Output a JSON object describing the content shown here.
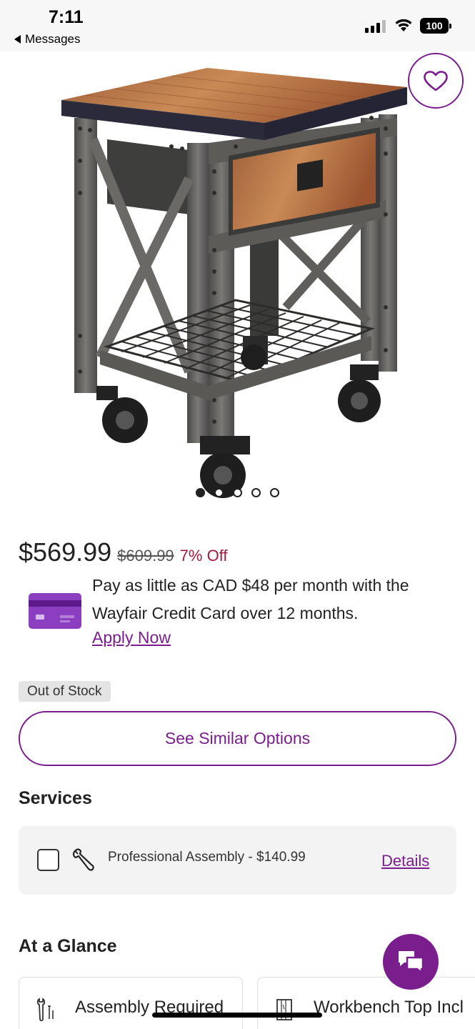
{
  "status_bar": {
    "time": "7:11",
    "back_label": "Messages",
    "battery": "100"
  },
  "product": {
    "image_alt": "Rolling workbench with wood top, drawer, wire shelf and casters",
    "image_count": 5,
    "active_image": 1
  },
  "pricing": {
    "price": "$569.99",
    "original_price": "$609.99",
    "discount": "7% Off"
  },
  "financing": {
    "text": "Pay as little as CAD $48 per month with the Wayfair Credit Card over 12 months.",
    "apply_label": "Apply Now"
  },
  "stock": {
    "badge": "Out of Stock",
    "similar_button": "See Similar Options"
  },
  "services": {
    "title": "Services",
    "item_label": "Professional Assembly - $140.99",
    "details_label": "Details",
    "checked": false
  },
  "glance": {
    "title": "At a Glance",
    "items": [
      {
        "label": "Assembly Required",
        "icon": "tools-icon"
      },
      {
        "label": "Workbench Top Incl",
        "icon": "wood-panel-icon"
      }
    ]
  },
  "colors": {
    "accent": "#7b1e8d",
    "discount": "#a01a3c"
  }
}
